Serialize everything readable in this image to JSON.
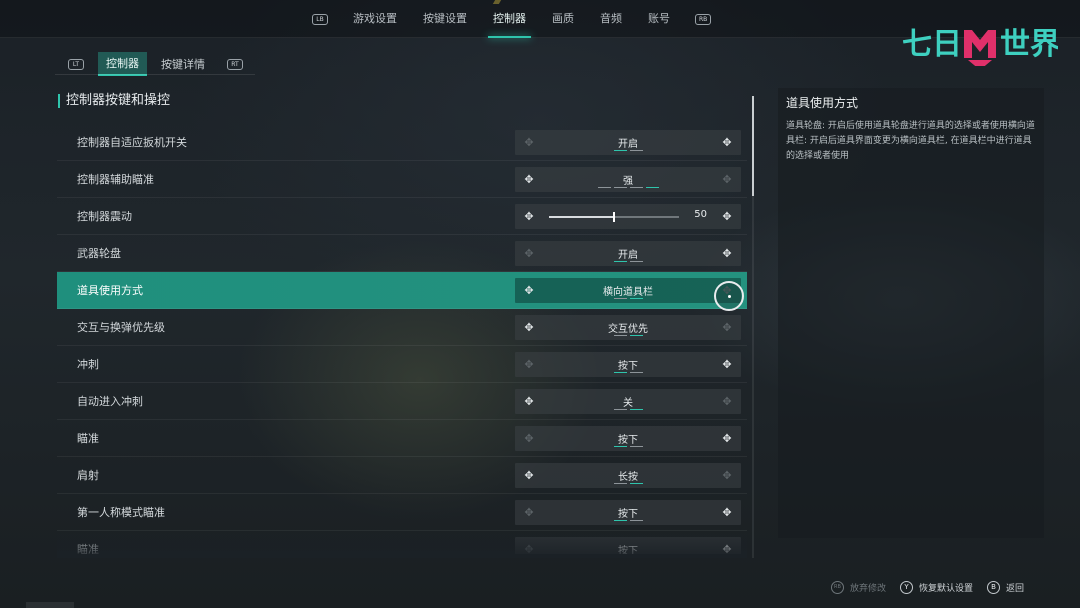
{
  "top_nav": {
    "left_button": "LB",
    "right_button": "RB",
    "tabs": [
      "游戏设置",
      "按键设置",
      "控制器",
      "画质",
      "音频",
      "账号"
    ],
    "active_index": 2
  },
  "logo": {
    "text": "七日世界"
  },
  "sub_nav": {
    "left_button": "LT",
    "right_button": "RT",
    "tabs": [
      "控制器",
      "按键详情"
    ],
    "active_index": 0
  },
  "section_title": "控制器按键和操控",
  "settings": [
    {
      "label": "控制器自适应扳机开关",
      "type": "option",
      "value": "开启",
      "dots": 2,
      "active_dot": 0,
      "left_enabled": false,
      "right_enabled": true
    },
    {
      "label": "控制器辅助瞄准",
      "type": "option",
      "value": "强",
      "dots": 4,
      "active_dot": 3,
      "left_enabled": true,
      "right_enabled": false
    },
    {
      "label": "控制器震动",
      "type": "slider",
      "value": "50",
      "level": 0.5,
      "left_enabled": true,
      "right_enabled": true
    },
    {
      "label": "武器轮盘",
      "type": "option",
      "value": "开启",
      "dots": 2,
      "active_dot": 0,
      "left_enabled": false,
      "right_enabled": true
    },
    {
      "label": "道具使用方式",
      "type": "option",
      "value": "横向道具栏",
      "dots": 2,
      "active_dot": 1,
      "left_enabled": true,
      "right_enabled": false,
      "selected": true
    },
    {
      "label": "交互与换弹优先级",
      "type": "option",
      "value": "交互优先",
      "dots": 2,
      "active_dot": 1,
      "left_enabled": true,
      "right_enabled": false
    },
    {
      "label": "冲刺",
      "type": "option",
      "value": "按下",
      "dots": 2,
      "active_dot": 0,
      "left_enabled": false,
      "right_enabled": true
    },
    {
      "label": "自动进入冲刺",
      "type": "option",
      "value": "关",
      "dots": 2,
      "active_dot": 1,
      "left_enabled": true,
      "right_enabled": false
    },
    {
      "label": "瞄准",
      "type": "option",
      "value": "按下",
      "dots": 2,
      "active_dot": 0,
      "left_enabled": false,
      "right_enabled": true
    },
    {
      "label": "肩射",
      "type": "option",
      "value": "长按",
      "dots": 2,
      "active_dot": 1,
      "left_enabled": true,
      "right_enabled": false
    },
    {
      "label": "第一人称模式瞄准",
      "type": "option",
      "value": "按下",
      "dots": 2,
      "active_dot": 0,
      "left_enabled": false,
      "right_enabled": true
    },
    {
      "label": "瞄准",
      "type": "option",
      "value": "按下",
      "dots": 2,
      "active_dot": 0,
      "left_enabled": false,
      "right_enabled": true
    }
  ],
  "description": {
    "title": "道具使用方式",
    "body": "道具轮盘: 开启后使用道具轮盘进行道具的选择或者使用横向道具栏: 开启后道具界面变更为横向道具栏, 在道具栏中进行道具的选择或者使用"
  },
  "footer": {
    "discard": {
      "button": "RB",
      "label": "放弃修改"
    },
    "restore": {
      "button": "Y",
      "label": "恢复默认设置"
    },
    "back": {
      "button": "B",
      "label": "返回"
    }
  },
  "scroll": {
    "position": 0.0
  },
  "icons": {
    "arrow_left": "dpad-left-icon",
    "arrow_right": "dpad-right-icon",
    "accent_color": "#2fc4ac",
    "selected_row_color": "#1f8f7d"
  }
}
